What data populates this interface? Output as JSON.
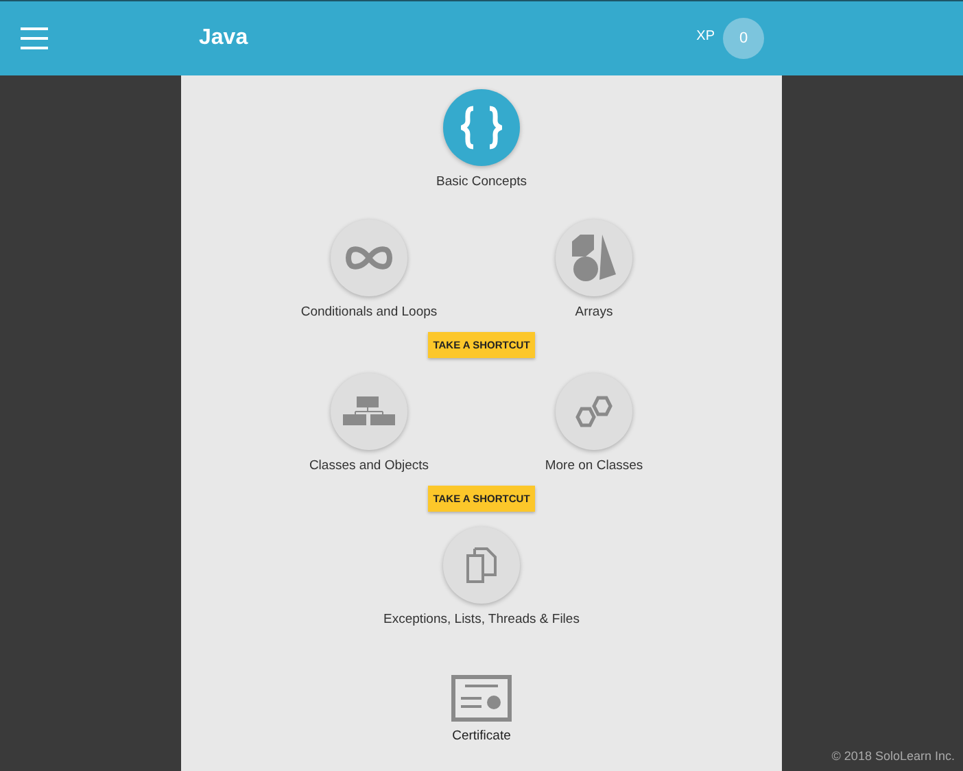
{
  "header": {
    "title": "Java",
    "xp_label": "XP",
    "xp_value": "0"
  },
  "path": [
    {
      "kind": "modules",
      "modules": [
        {
          "title": "Basic Concepts",
          "unlocked": true
        }
      ]
    },
    {
      "kind": "modules",
      "modules": [
        {
          "title": "Conditionals and Loops",
          "unlocked": false
        },
        {
          "title": "Arrays",
          "unlocked": false
        }
      ]
    },
    {
      "kind": "shortcut",
      "label": "TAKE A SHORTCUT"
    },
    {
      "kind": "modules",
      "modules": [
        {
          "title": "Classes and Objects",
          "unlocked": false
        },
        {
          "title": "More on Classes",
          "unlocked": false
        }
      ]
    },
    {
      "kind": "shortcut",
      "label": "TAKE A SHORTCUT"
    },
    {
      "kind": "modules",
      "modules": [
        {
          "title": "Exceptions, Lists, Threads & Files",
          "unlocked": false
        }
      ]
    },
    {
      "kind": "certificate",
      "label": "Certificate"
    }
  ],
  "footer": "© 2018 SoloLearn Inc."
}
